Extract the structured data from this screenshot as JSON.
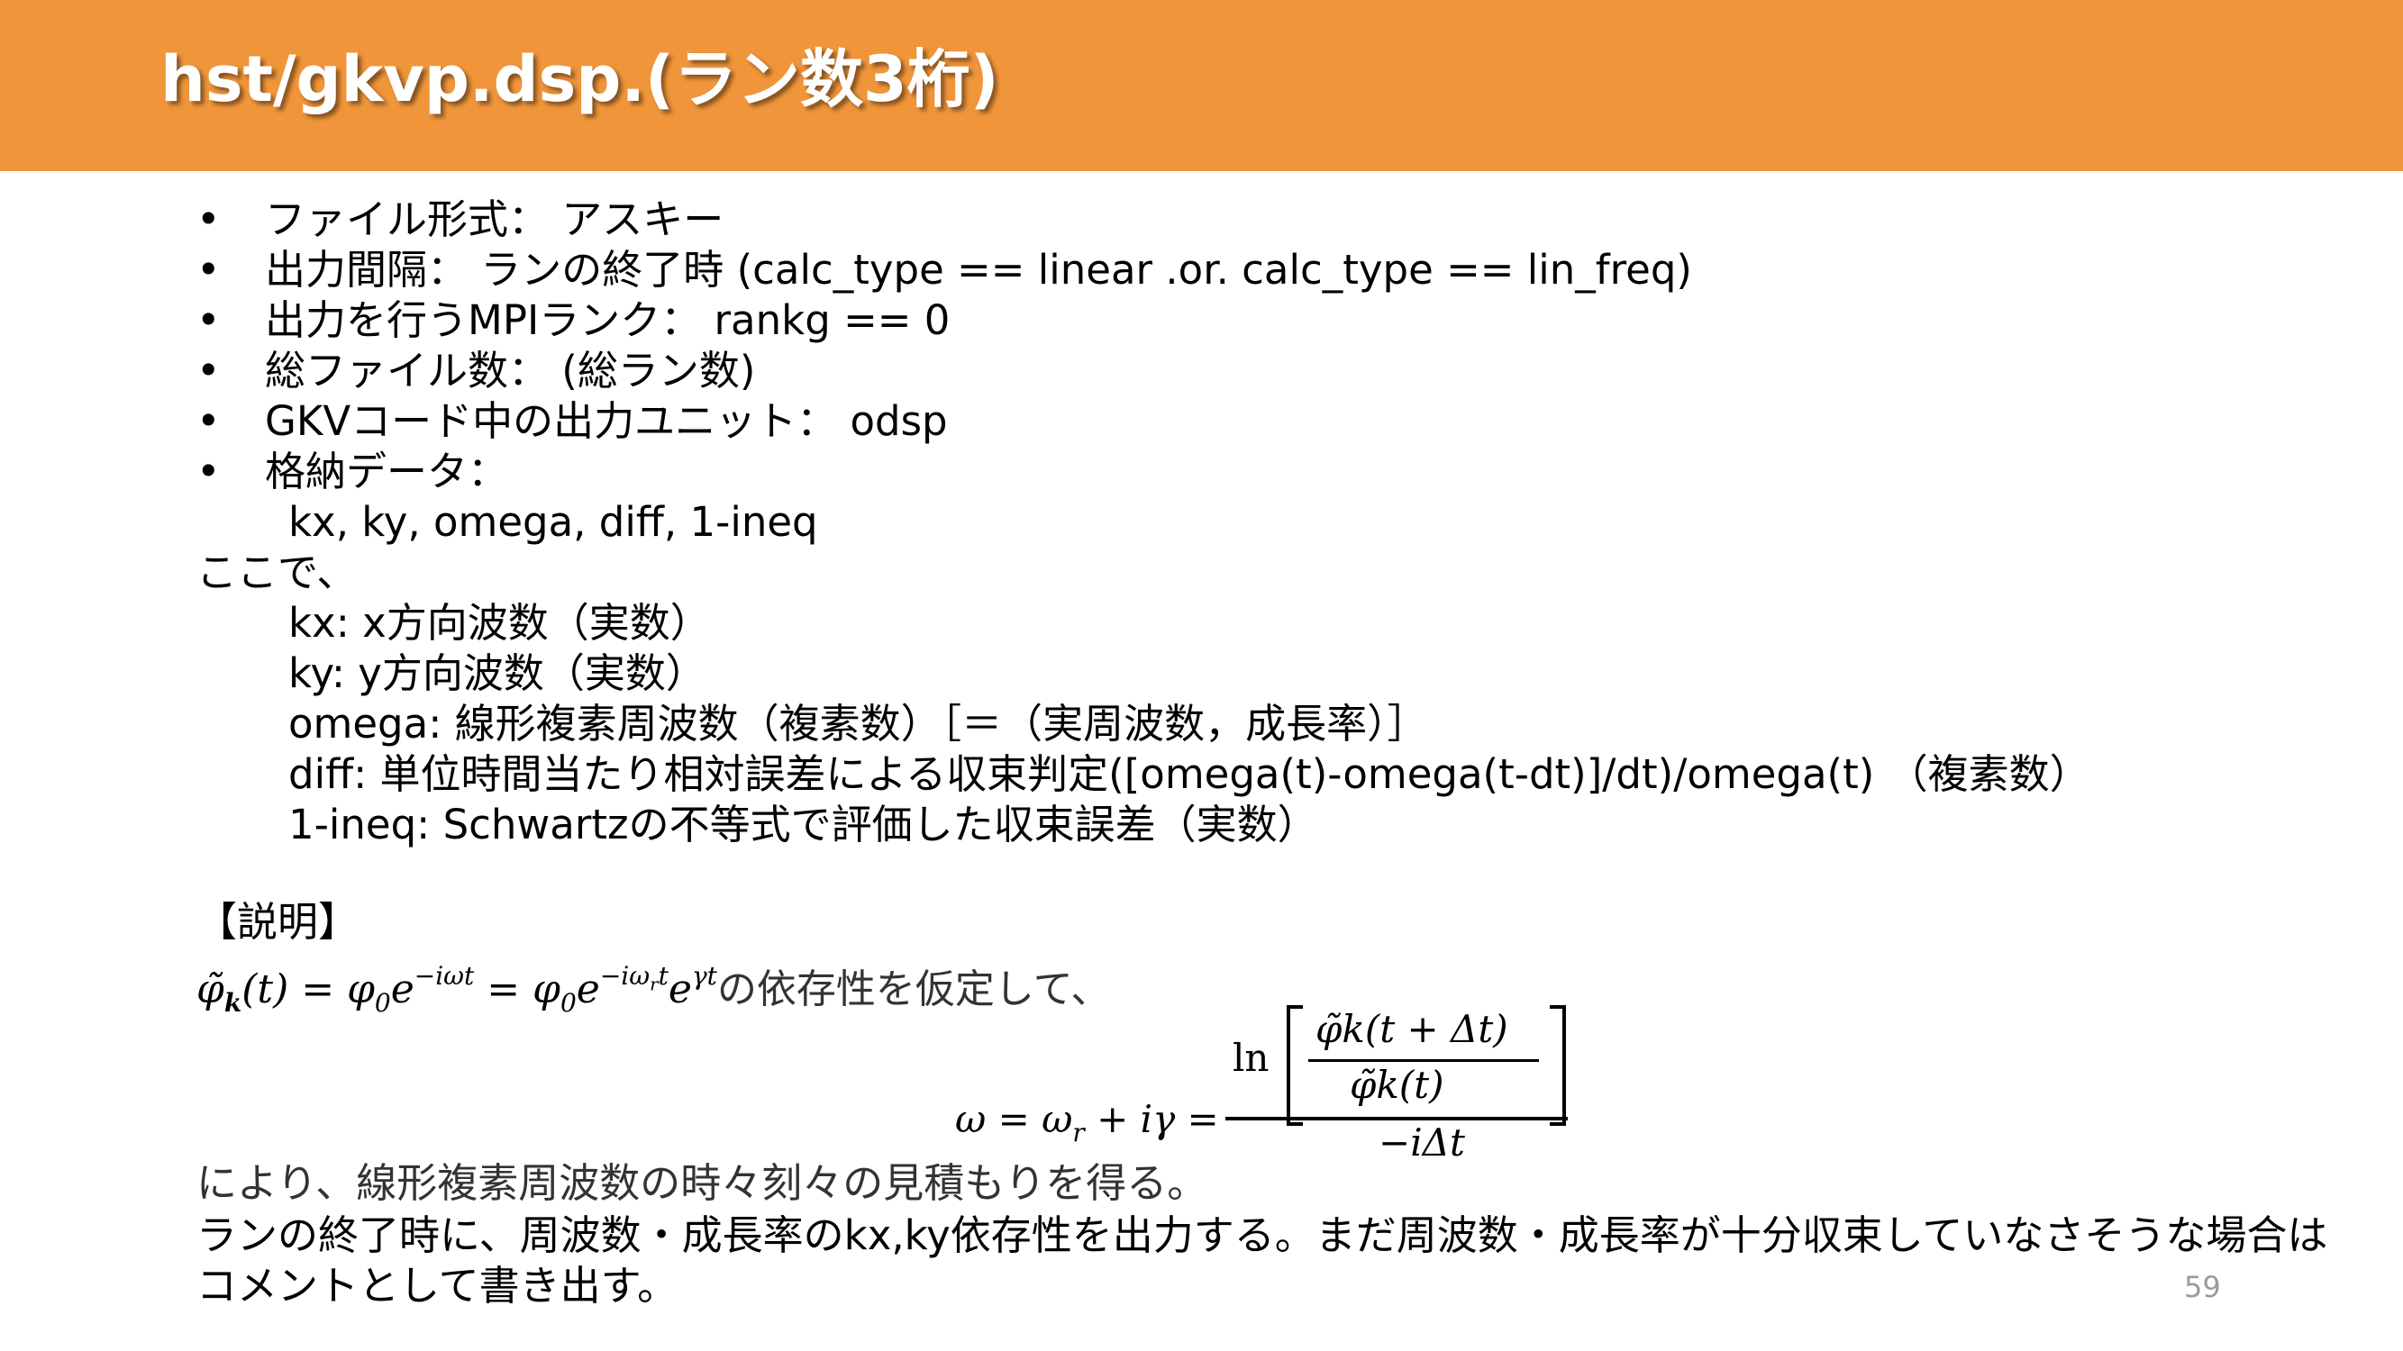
{
  "header": {
    "title": "hst/gkvp.dsp.(ラン数3桁)",
    "background_color": "#f0953a"
  },
  "bullets": [
    "ファイル形式： アスキー",
    "出力間隔： ランの終了時 (calc_type == linear .or. calc_type == lin_freq)",
    "出力を行うMPIランク： rankg == 0",
    "総ファイル数： (総ラン数)",
    "GKVコード中の出力ユニット： odsp",
    "格納データ："
  ],
  "bullet_symbol": "•",
  "stored_data": "kx, ky, omega, diff, 1-ineq",
  "where_label": "ここで、",
  "definitions": [
    "kx: x方向波数（実数）",
    "ky: y方向波数（実数）",
    "omega: 線形複素周波数（複素数）［＝（実周波数，成長率）］",
    "diff: 単位時間当たり相対誤差による収束判定([omega(t)-omega(t-dt)]/dt)/omega(t) （複素数）",
    "1-ineq: Schwartzの不等式で評価した収束誤差（実数）"
  ],
  "explanation_heading": "【説明】",
  "equation1_suffix": "の依存性を仮定して、",
  "equation2": {
    "lhs": "ω = ω",
    "lhs_sub": "r",
    "lhs_rest": " + iγ =",
    "ln": "ln",
    "inner_numerator": "φ̃k(t + Δt)",
    "inner_denominator": "φ̃k(t)",
    "denominator": "−iΔt"
  },
  "explanation_line": "により、線形複素周波数の時々刻々の見積もりを得る。",
  "summary_line1": "ランの終了時に、周波数・成長率のkx,ky依存性を出力する。まだ周波数・成長率が十分収束していなさそうな場合は",
  "summary_line2": "コメントとして書き出す。",
  "page_number": "59"
}
